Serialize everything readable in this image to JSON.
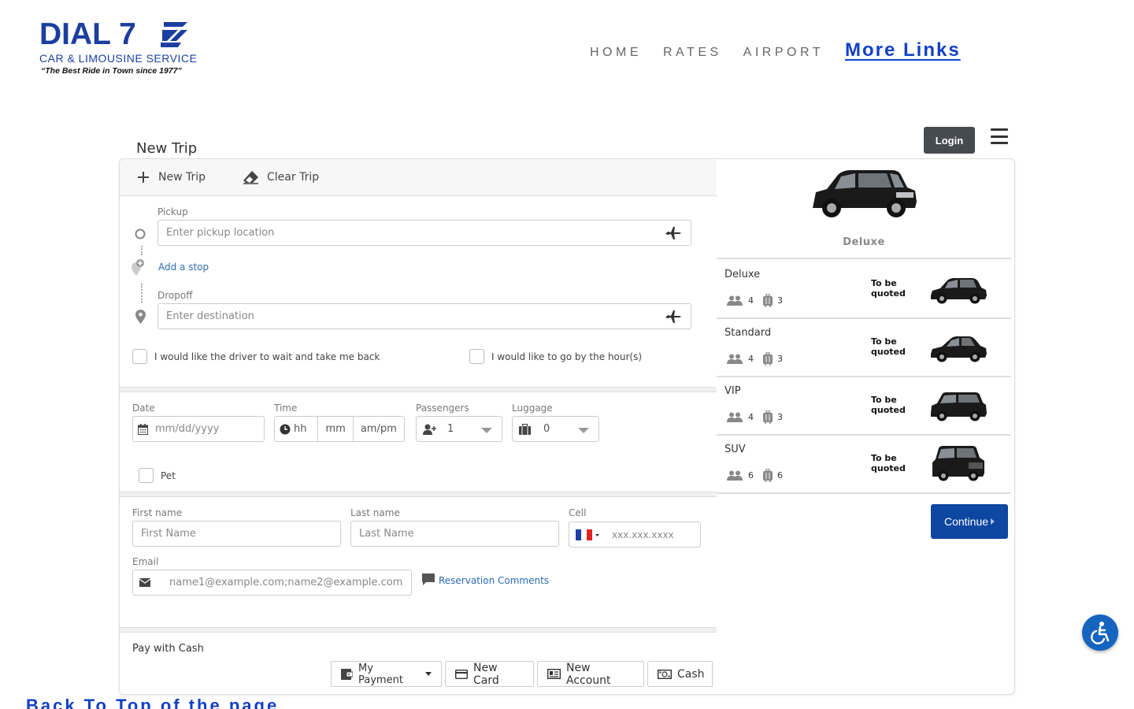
{
  "brand": {
    "name": "DIAL 7",
    "subtitle": "CAR & LIMOUSINE SERVICE",
    "tagline": "“The Best Ride in Town since 1977”",
    "color": "#1b3ea0"
  },
  "nav": {
    "items": [
      "HOME",
      "RATES",
      "AIRPORT"
    ],
    "more": "More Links"
  },
  "page": {
    "title": "New Trip",
    "login": "Login"
  },
  "toolbar": {
    "new_trip": "New Trip",
    "clear_trip": "Clear Trip"
  },
  "route": {
    "pickup_label": "Pickup",
    "pickup_placeholder": "Enter pickup location",
    "add_stop": "Add a stop",
    "dropoff_label": "Dropoff",
    "dropoff_placeholder": "Enter destination",
    "wait_option": "I would like the driver to wait and take me back",
    "hourly_option": "I would like to go by the hour(s)"
  },
  "schedule": {
    "date_label": "Date",
    "date_placeholder": "mm/dd/yyyy",
    "time_label": "Time",
    "hh": "hh",
    "mm": "mm",
    "ampm": "am/pm",
    "passengers_label": "Passengers",
    "passengers_value": "1",
    "luggage_label": "Luggage",
    "luggage_value": "0",
    "pet": "Pet"
  },
  "contact": {
    "first_label": "First name",
    "first_placeholder": "First Name",
    "last_label": "Last name",
    "last_placeholder": "Last Name",
    "cell_label": "Cell",
    "cell_placeholder": "xxx.xxx.xxxx",
    "email_label": "Email",
    "email_placeholder": "name1@example.com;name2@example.com",
    "comments": "Reservation Comments"
  },
  "payment": {
    "title": "Pay with Cash",
    "my_payment": "My Payment",
    "new_card": "New Card",
    "new_account": "New Account",
    "cash": "Cash"
  },
  "vehicles": {
    "selected": "Deluxe",
    "list": [
      {
        "name": "Deluxe",
        "passengers": "4",
        "luggage": "3",
        "price": "To be quoted"
      },
      {
        "name": "Standard",
        "passengers": "4",
        "luggage": "3",
        "price": "To be quoted"
      },
      {
        "name": "VIP",
        "passengers": "4",
        "luggage": "3",
        "price": "To be quoted"
      },
      {
        "name": "SUV",
        "passengers": "6",
        "luggage": "6",
        "price": "To be quoted"
      }
    ],
    "continue": "Continue"
  },
  "footer": {
    "back_top": "Back To Top of the page"
  },
  "colors": {
    "primary": "#0d47a1",
    "link": "#2a6bb3",
    "nav_more": "#1240c6"
  }
}
